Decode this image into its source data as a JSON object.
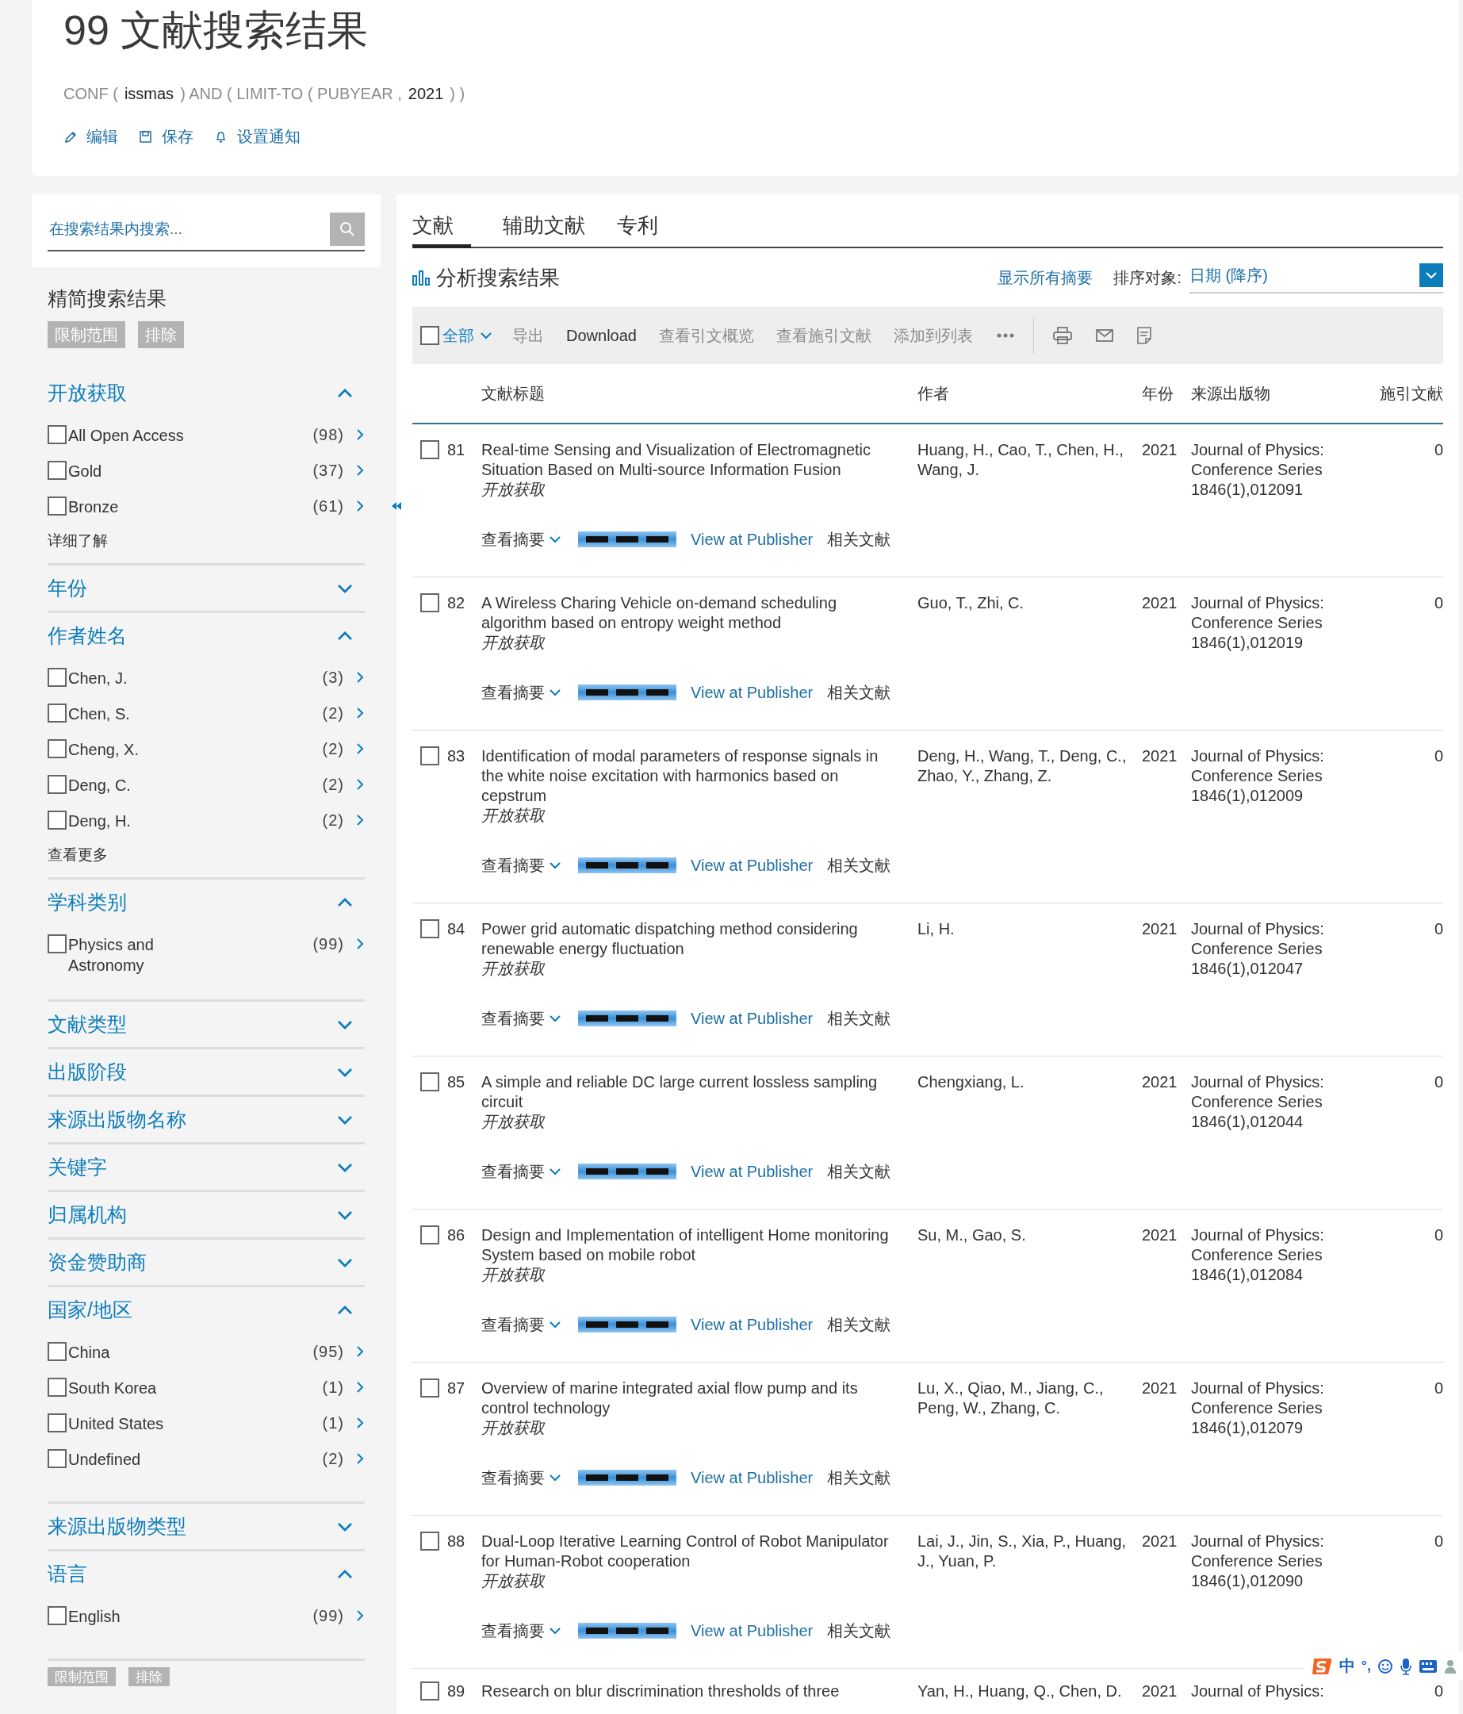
{
  "header": {
    "title": "99 文献搜索结果",
    "query": [
      {
        "kind": "op",
        "text": "CONF ("
      },
      {
        "kind": "term",
        "text": "issmas"
      },
      {
        "kind": "op",
        "text": ") AND ( LIMIT-TO ( PUBYEAR ,"
      },
      {
        "kind": "term",
        "text": "2021"
      },
      {
        "kind": "op",
        "text": ") )"
      }
    ],
    "actions": [
      "编辑",
      "保存",
      "设置通知"
    ]
  },
  "sidebar": {
    "search": {
      "placeholder": "在搜索结果内搜索..."
    },
    "refine_title": "精简搜索结果",
    "refine_buttons": [
      "限制范围",
      "排除"
    ],
    "facets": [
      {
        "title": "开放获取",
        "expanded": true,
        "items": [
          {
            "label": "All Open Access",
            "count": "(98)",
            "checked": false
          },
          {
            "label": "Gold",
            "count": "(37)",
            "checked": false
          },
          {
            "label": "Bronze",
            "count": "(61)",
            "checked": false
          }
        ],
        "more": "详细了解"
      },
      {
        "title": "年份",
        "expanded": false
      },
      {
        "title": "作者姓名",
        "expanded": true,
        "items": [
          {
            "label": "Chen, J.",
            "count": "(3)",
            "checked": false
          },
          {
            "label": "Chen, S.",
            "count": "(2)",
            "checked": false
          },
          {
            "label": "Cheng, X.",
            "count": "(2)",
            "checked": false
          },
          {
            "label": "Deng, C.",
            "count": "(2)",
            "checked": false
          },
          {
            "label": "Deng, H.",
            "count": "(2)",
            "checked": false
          }
        ],
        "more": "查看更多"
      },
      {
        "title": "学科类别",
        "expanded": true,
        "items": [
          {
            "label": "Physics and Astronomy",
            "count": "(99)",
            "checked": false
          }
        ]
      },
      {
        "title": "文献类型",
        "expanded": false
      },
      {
        "title": "出版阶段",
        "expanded": false
      },
      {
        "title": "来源出版物名称",
        "expanded": false
      },
      {
        "title": "关键字",
        "expanded": false
      },
      {
        "title": "归属机构",
        "expanded": false
      },
      {
        "title": "资金赞助商",
        "expanded": false
      },
      {
        "title": "国家/地区",
        "expanded": true,
        "items": [
          {
            "label": "China",
            "count": "(95)",
            "checked": false
          },
          {
            "label": "South Korea",
            "count": "(1)",
            "checked": false
          },
          {
            "label": "United States",
            "count": "(1)",
            "checked": false
          },
          {
            "label": "Undefined",
            "count": "(2)",
            "checked": false
          }
        ]
      },
      {
        "title": "来源出版物类型",
        "expanded": false
      },
      {
        "title": "语言",
        "expanded": true,
        "items": [
          {
            "label": "English",
            "count": "(99)",
            "checked": false
          }
        ]
      }
    ],
    "bottom_buttons": [
      "限制范围",
      "排除"
    ]
  },
  "main": {
    "tabs": [
      {
        "label": "文献",
        "selected": true
      },
      {
        "label": "辅助文献",
        "selected": false
      },
      {
        "label": "专利",
        "selected": false
      }
    ],
    "analyze": "分析搜索结果",
    "show_abstracts": "显示所有摘要",
    "sort_label": "排序对象:",
    "sort_value": "日期 (降序)",
    "toolbar": {
      "select_all": "全部",
      "select_all_checked": false,
      "actions": [
        {
          "label": "导出",
          "disabled": true
        },
        {
          "label": "Download",
          "disabled": false
        },
        {
          "label": "查看引文概览",
          "disabled": true
        },
        {
          "label": "查看施引文献",
          "disabled": true
        },
        {
          "label": "添加到列表",
          "disabled": true
        }
      ]
    },
    "columns": [
      "文献标题",
      "作者",
      "年份",
      "来源出版物",
      "施引文献"
    ],
    "rows": [
      {
        "number": "81",
        "checked": false,
        "title": "Real-time Sensing and Visualization of Electromagnetic Situation Based on Multi-source Information Fusion",
        "access": "开放获取",
        "authors": "Huang, H., Cao, T., Chen, H., Wang, J.",
        "year": "2021",
        "source": "Journal of Physics: Conference Series 1846(1),012091",
        "citations": "0",
        "abstract": "查看摘要",
        "publisher": "View at Publisher",
        "related": "相关文献"
      },
      {
        "number": "82",
        "checked": false,
        "title": "A Wireless Charing Vehicle on-demand scheduling algorithm based on entropy weight method",
        "access": "开放获取",
        "authors": "Guo, T., Zhi, C.",
        "year": "2021",
        "source": "Journal of Physics: Conference Series 1846(1),012019",
        "citations": "0",
        "abstract": "查看摘要",
        "publisher": "View at Publisher",
        "related": "相关文献"
      },
      {
        "number": "83",
        "checked": false,
        "title": "Identification of modal parameters of response signals in the white noise excitation with harmonics based on cepstrum",
        "access": "开放获取",
        "authors": "Deng, H., Wang, T., Deng, C., Zhao, Y., Zhang, Z.",
        "year": "2021",
        "source": "Journal of Physics: Conference Series 1846(1),012009",
        "citations": "0",
        "abstract": "查看摘要",
        "publisher": "View at Publisher",
        "related": "相关文献"
      },
      {
        "number": "84",
        "checked": false,
        "title": "Power grid automatic dispatching method considering renewable energy fluctuation",
        "access": "开放获取",
        "authors": "Li, H.",
        "year": "2021",
        "source": "Journal of Physics: Conference Series 1846(1),012047",
        "citations": "0",
        "abstract": "查看摘要",
        "publisher": "View at Publisher",
        "related": "相关文献"
      },
      {
        "number": "85",
        "checked": false,
        "title": "A simple and reliable DC large current lossless sampling circuit",
        "access": "开放获取",
        "authors": "Chengxiang, L.",
        "year": "2021",
        "source": "Journal of Physics: Conference Series 1846(1),012044",
        "citations": "0",
        "abstract": "查看摘要",
        "publisher": "View at Publisher",
        "related": "相关文献"
      },
      {
        "number": "86",
        "checked": false,
        "title": "Design and Implementation of intelligent Home monitoring System based on mobile robot",
        "access": "开放获取",
        "authors": "Su, M., Gao, S.",
        "year": "2021",
        "source": "Journal of Physics: Conference Series 1846(1),012084",
        "citations": "0",
        "abstract": "查看摘要",
        "publisher": "View at Publisher",
        "related": "相关文献"
      },
      {
        "number": "87",
        "checked": false,
        "title": "Overview of marine integrated axial flow pump and its control technology",
        "access": "开放获取",
        "authors": "Lu, X., Qiao, M., Jiang, C., Peng, W., Zhang, C.",
        "year": "2021",
        "source": "Journal of Physics: Conference Series 1846(1),012079",
        "citations": "0",
        "abstract": "查看摘要",
        "publisher": "View at Publisher",
        "related": "相关文献"
      },
      {
        "number": "88",
        "checked": false,
        "title": "Dual-Loop Iterative Learning Control of Robot Manipulator for Human-Robot cooperation",
        "access": "开放获取",
        "authors": "Lai, J., Jin, S., Xia, P., Huang, J., Yuan, P.",
        "year": "2021",
        "source": "Journal of Physics: Conference Series 1846(1),012090",
        "citations": "0",
        "abstract": "查看摘要",
        "publisher": "View at Publisher",
        "related": "相关文献"
      },
      {
        "number": "89",
        "checked": false,
        "title": "Research on blur discrimination thresholds of three",
        "authors": "Yan, H., Huang, Q., Chen, D.",
        "year": "2021",
        "source": "Journal of Physics:",
        "citations": "0"
      }
    ]
  },
  "ime_toolbar": {
    "mode": "中",
    "punctuation": "°,"
  }
}
